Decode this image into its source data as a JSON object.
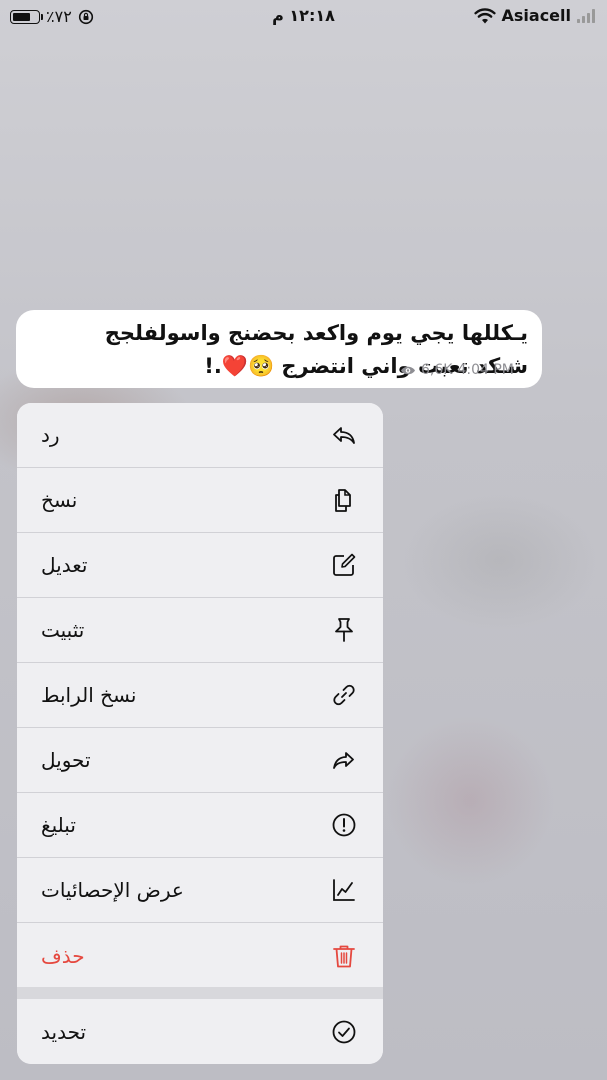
{
  "status_bar": {
    "battery_percent": "٪٧٢",
    "battery_level": 0.72,
    "time": "١٢:١٨ م",
    "carrier": "Asiacell"
  },
  "message": {
    "line1": "يـكللها يجي يوم واكعد بحضنج واسولفلجج",
    "line2": "شـكد تعبت واني انتضرج 🥺❤️.!",
    "views": "6,6K",
    "time": "4:04 PM"
  },
  "menu": {
    "items": [
      {
        "label": "رد",
        "icon": "reply-icon"
      },
      {
        "label": "نسخ",
        "icon": "copy-icon"
      },
      {
        "label": "تعديل",
        "icon": "edit-icon"
      },
      {
        "label": "تثبيت",
        "icon": "pin-icon"
      },
      {
        "label": "نسخ الرابط",
        "icon": "link-icon"
      },
      {
        "label": "تحويل",
        "icon": "forward-icon"
      },
      {
        "label": "تبليغ",
        "icon": "report-icon"
      },
      {
        "label": "عرض الإحصائيات",
        "icon": "stats-icon"
      },
      {
        "label": "حذف",
        "icon": "trash-icon"
      },
      {
        "label": "تحديد",
        "icon": "select-icon"
      }
    ]
  },
  "colors": {
    "danger": "#e5483f",
    "text": "#111111",
    "secondary": "#8e8e93"
  }
}
